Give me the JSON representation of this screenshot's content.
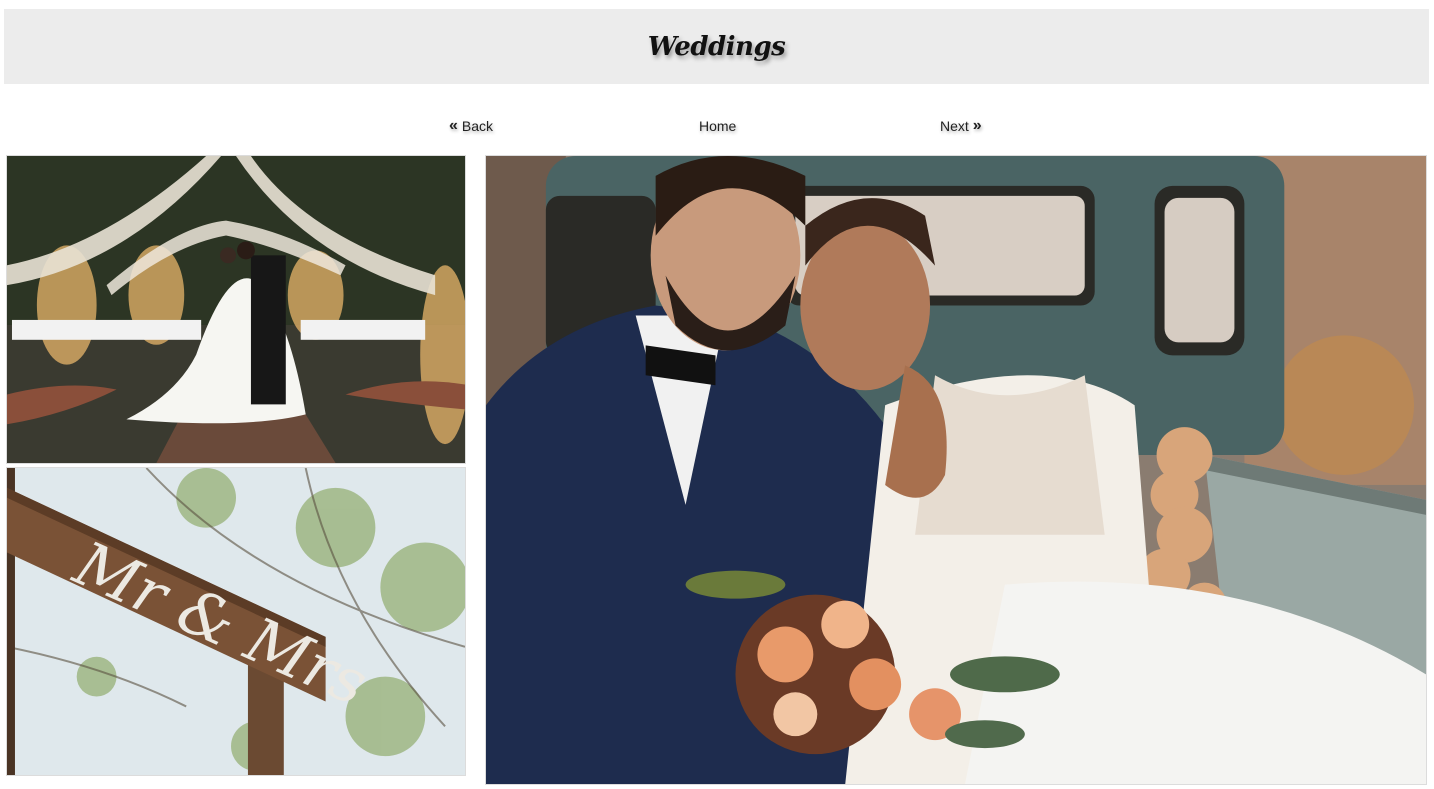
{
  "header": {
    "title": "Weddings"
  },
  "nav": {
    "back_label": "Back",
    "home_label": "Home",
    "next_label": "Next",
    "back_icon": "double-chevron-left-icon",
    "next_icon": "double-chevron-right-icon"
  },
  "gallery": {
    "sign_text": "Mr & Mrs"
  }
}
